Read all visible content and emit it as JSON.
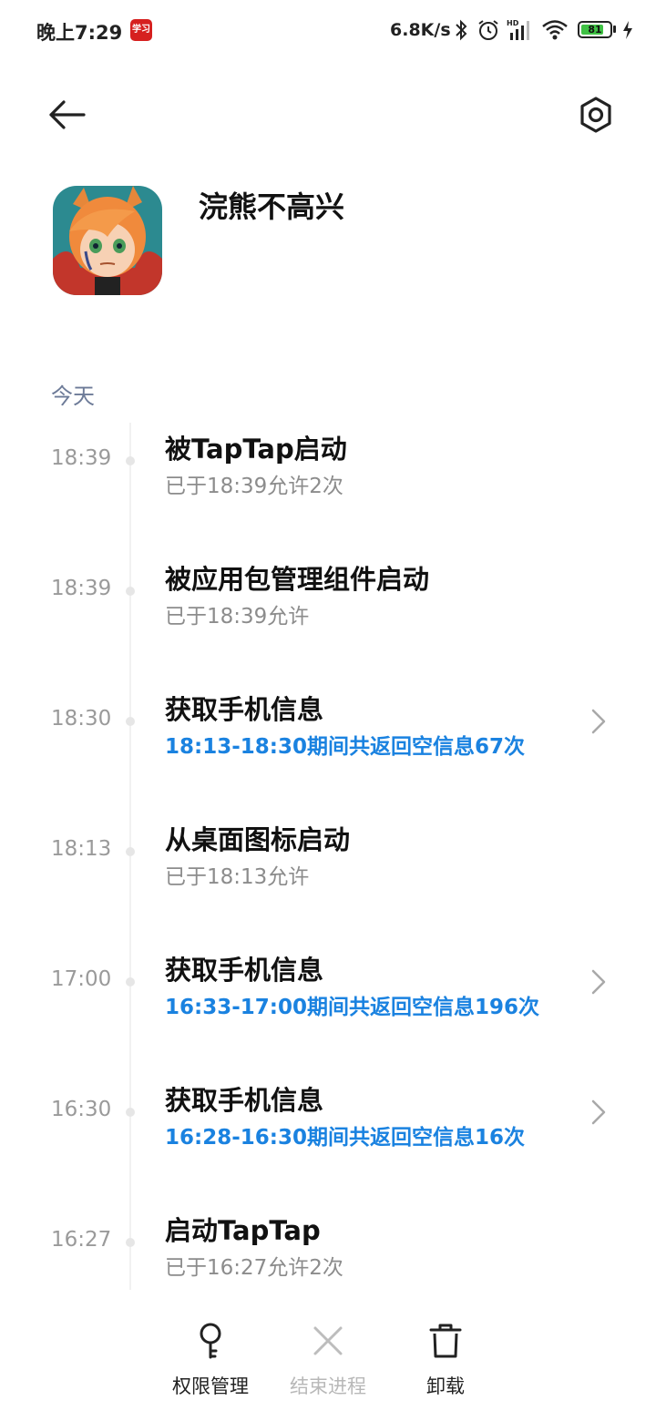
{
  "status_bar": {
    "time": "晚上7:29",
    "app_badge": "学习",
    "net_speed": "6.8K/s",
    "battery": "81",
    "battery_color": "#3fc144"
  },
  "nav": {
    "back_icon": "arrow-left-icon",
    "settings_icon": "hexagon-gear-icon"
  },
  "app": {
    "name": "浣熊不高兴"
  },
  "section": {
    "label": "今天"
  },
  "timeline": [
    {
      "time": "18:39",
      "title": "被TapTap启动",
      "sub": "已于18:39允许2次",
      "sub_style": "gray",
      "has_chevron": false
    },
    {
      "time": "18:39",
      "title": "被应用包管理组件启动",
      "sub": "已于18:39允许",
      "sub_style": "gray",
      "has_chevron": false
    },
    {
      "time": "18:30",
      "title": "获取手机信息",
      "sub": "18:13-18:30期间共返回空信息67次",
      "sub_style": "blue",
      "has_chevron": true
    },
    {
      "time": "18:13",
      "title": "从桌面图标启动",
      "sub": "已于18:13允许",
      "sub_style": "gray",
      "has_chevron": false
    },
    {
      "time": "17:00",
      "title": "获取手机信息",
      "sub": "16:33-17:00期间共返回空信息196次",
      "sub_style": "blue",
      "has_chevron": true
    },
    {
      "time": "16:30",
      "title": "获取手机信息",
      "sub": "16:28-16:30期间共返回空信息16次",
      "sub_style": "blue",
      "has_chevron": true
    },
    {
      "time": "16:27",
      "title": "启动TapTap",
      "sub": "已于16:27允许2次",
      "sub_style": "gray",
      "has_chevron": false
    }
  ],
  "bottom_bar": {
    "permissions": {
      "label": "权限管理",
      "icon": "key-icon"
    },
    "end_process": {
      "label": "结束进程",
      "icon": "close-icon",
      "enabled": false
    },
    "uninstall": {
      "label": "卸载",
      "icon": "trash-icon"
    }
  },
  "colors": {
    "accent_blue": "#1a82e0",
    "section_label": "#6d7b98",
    "muted_text": "#8c8c8c"
  }
}
